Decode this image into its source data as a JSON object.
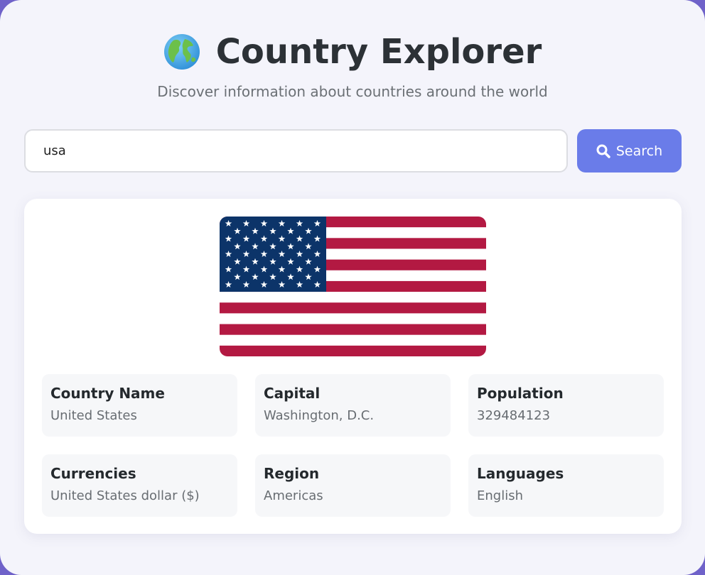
{
  "header": {
    "title": "Country Explorer",
    "subtitle": "Discover information about countries around the world",
    "icon": "globe-icon"
  },
  "search": {
    "value": "usa",
    "button_label": "Search",
    "button_icon": "search-icon"
  },
  "result": {
    "flag": "united-states-flag",
    "fields": [
      {
        "label": "Country Name",
        "value": "United States"
      },
      {
        "label": "Capital",
        "value": "Washington, D.C."
      },
      {
        "label": "Population",
        "value": "329484123"
      },
      {
        "label": "Currencies",
        "value": "United States dollar ($)"
      },
      {
        "label": "Region",
        "value": "Americas"
      },
      {
        "label": "Languages",
        "value": "English"
      }
    ]
  },
  "colors": {
    "accent": "#6a7ce9",
    "background": "#6f62c9",
    "flag_red": "#b22234",
    "flag_blue": "#3c3b6e"
  }
}
